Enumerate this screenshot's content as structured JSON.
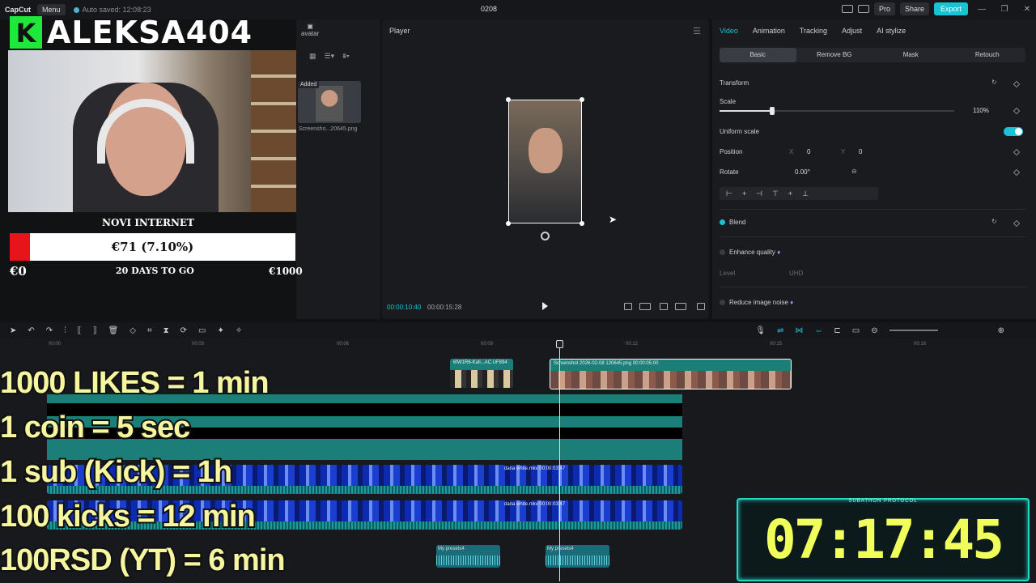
{
  "titlebar": {
    "app": "CapCut",
    "menu": "Menu",
    "autosave": "Auto saved: 12:08:23",
    "project": "0208",
    "pro": "Pro",
    "share": "Share",
    "export": "Export"
  },
  "media": {
    "tab": "avatar",
    "added": "Added",
    "thumb_label": "Screensho...20645.png"
  },
  "player": {
    "title": "Player",
    "current": "00:00:10:40",
    "total": "00:00:15:28"
  },
  "inspector": {
    "tabs": [
      "Video",
      "Animation",
      "Tracking",
      "Adjust",
      "AI stylize"
    ],
    "subtabs": [
      "Basic",
      "Remove BG",
      "Mask",
      "Retouch"
    ],
    "transform": "Transform",
    "scale": "Scale",
    "scale_val": "110%",
    "uniform": "Uniform scale",
    "position": "Position",
    "pos_x_lbl": "X",
    "pos_x": "0",
    "pos_y_lbl": "Y",
    "pos_y": "0",
    "rotate": "Rotate",
    "rotate_val": "0.00°",
    "blend": "Blend",
    "enhance": "Enhance quality",
    "level": "Level",
    "level_val": "UHD",
    "reduce": "Reduce image noise",
    "accent": "#19c3d6"
  },
  "ruler": [
    "00:00",
    "00:03",
    "00:06",
    "00:09",
    "00:12",
    "00:15",
    "00:18"
  ],
  "clips": {
    "c1": "6fW1R6-Kall...AC.UF894",
    "c2": "Screenshot 2026-02-08 120645.png  00:00:05:00",
    "v1": "dana white.mkv   00:00:03:47",
    "v2": "dana white.mkv   00:00:03:47",
    "a1": "My presets4",
    "a2": "My presets4"
  },
  "overlay": {
    "k": "K",
    "name": "ALEKSA404",
    "goal_title": "NOVI INTERNET",
    "goal_value": "€71 (7.10%)",
    "goal_progress": 7.1,
    "goal_min": "€0",
    "goal_days": "20 DAYS TO GO",
    "goal_max": "€1000",
    "rules": [
      "1000 LIKES = 1 min",
      "1 coin = 5 sec",
      "1 sub (Kick) = 1h",
      "100 kicks = 12 min",
      "100RSD (YT) = 6 min"
    ],
    "timer_title": "SUBATHON PROTOCOL",
    "timer": "07:17:45"
  }
}
